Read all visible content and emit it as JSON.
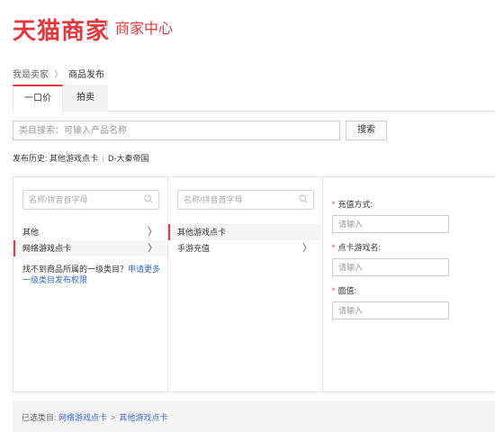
{
  "header": {
    "logo": "天猫商家",
    "center_title": "商家中心"
  },
  "breadcrumb": {
    "root": "我是卖家",
    "separator": "〉",
    "current": "商品发布"
  },
  "tabs": [
    {
      "label": "一口价",
      "active": true
    },
    {
      "label": "拍卖",
      "active": false
    }
  ],
  "search": {
    "placeholder": "类目搜索：可输入产品名称",
    "value": "",
    "button_label": "搜索"
  },
  "history": {
    "label": "发布历史:",
    "items": [
      "其他游戏点卡",
      "D-大秦帝国"
    ]
  },
  "column1": {
    "search_placeholder": "名称/拼音首字母",
    "items": [
      {
        "label": "其他",
        "has_children": true,
        "selected": false
      },
      {
        "label": "网络游戏点卡",
        "has_children": true,
        "selected": true
      }
    ],
    "not_found_text": "找不到商品所属的一级类目？",
    "not_found_link": "申请更多一级类目发布权限",
    "arrow": "〉"
  },
  "column2": {
    "search_placeholder": "名称/拼音首字母",
    "items": [
      {
        "label": "其他游戏点卡",
        "has_children": false,
        "selected": true
      },
      {
        "label": "手游充值",
        "has_children": true,
        "selected": false
      }
    ],
    "arrow": "〉"
  },
  "column3": {
    "required_mark": "*",
    "fields": [
      {
        "label": "充值方式:",
        "placeholder": "请输入",
        "value": ""
      },
      {
        "label": "点卡游戏名:",
        "placeholder": "请输入",
        "value": ""
      },
      {
        "label": "面值:",
        "placeholder": "请输入",
        "value": ""
      }
    ]
  },
  "selected_path": {
    "label": "已选类目:",
    "first": "网络游戏点卡",
    "separator": ">",
    "second": "其他游戏点卡"
  },
  "colors": {
    "brand": "#e4393c",
    "link": "#3366cc"
  }
}
